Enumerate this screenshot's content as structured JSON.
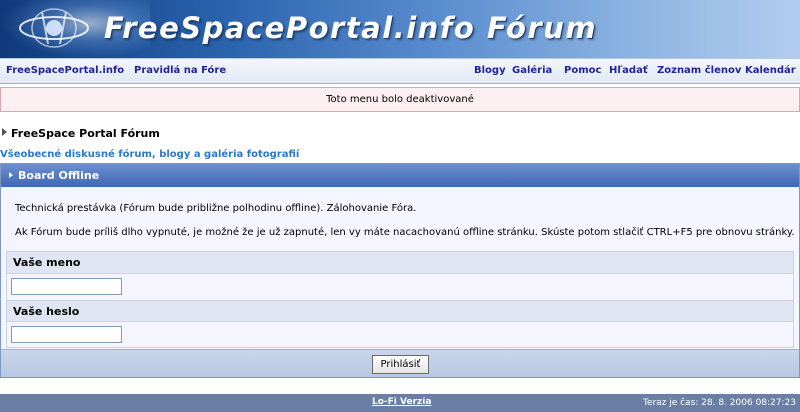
{
  "header": {
    "title": "FreeSpacePortal.info Fórum"
  },
  "nav": {
    "left": [
      "FreeSpacePortal.info",
      "Pravidlá na Fóre"
    ],
    "right": [
      "Blogy",
      "Galéria",
      "Pomoc",
      "Hľadať",
      "Zoznam členov",
      "Kalendár"
    ]
  },
  "notice": "Toto menu bolo deaktivované",
  "breadcrumb": "FreeSpace Portal Fórum",
  "subtitle": "Všeobecné diskusné fórum, blogy a galéria fotografií",
  "panel": {
    "title": "Board Offline",
    "message1": "Technická prestávka (Fórum bude približne polhodinu offline). Zálohovanie Fóra.",
    "message2": "Ak Fórum bude príliš dlho vypnuté, je možné že je už zapnuté, len vy máte nacachovanú offline stránku. Skúste potom stlačiť CTRL+F5 pre obnovu stránky.",
    "username_label": "Vaše meno",
    "username_value": "",
    "password_label": "Vaše heslo",
    "password_value": "",
    "login_button": "Prihlásiť"
  },
  "footer": {
    "lofi": "Lo-Fi Verzia",
    "time": "Teraz je čas: 28. 8. 2006 08:27:23"
  },
  "colors": {
    "banner": "#2a63ad",
    "nav_link": "#22229c",
    "panel_header": "#3f68b4",
    "footer": "#6b7fa6"
  }
}
